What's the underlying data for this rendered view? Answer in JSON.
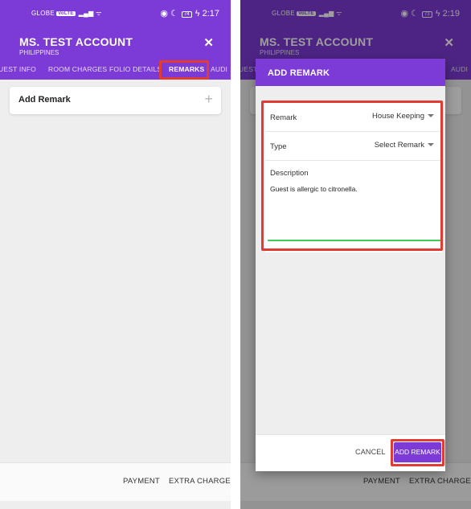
{
  "left": {
    "status": {
      "carrier": "GLOBE",
      "volte": "VoLTE",
      "battery": "74",
      "time": "2:17"
    },
    "header": {
      "title": "MS. TEST ACCOUNT",
      "subtitle": "PHILIPPINES"
    },
    "tabs": [
      {
        "label": "UEST INFO"
      },
      {
        "label": "ROOM CHARGES"
      },
      {
        "label": "FOLIO DETAILS"
      },
      {
        "label": "REMARKS"
      },
      {
        "label": "AUDI"
      }
    ],
    "add_remark_label": "Add Remark",
    "bottom": {
      "payment": "PAYMENT",
      "extra_charge": "EXTRA CHARGE"
    }
  },
  "right": {
    "status": {
      "carrier": "GLOBE",
      "volte": "VoLTE",
      "battery": "73",
      "time": "2:19"
    },
    "header": {
      "title": "MS. TEST ACCOUNT",
      "subtitle": "PHILIPPINES"
    },
    "tab_left_fragment": "UEST",
    "tab_right_fragment": "AUDI",
    "dialog": {
      "title": "ADD REMARK",
      "remark_label": "Remark",
      "remark_value": "House Keeping",
      "type_label": "Type",
      "type_value": "Select Remark",
      "description_label": "Description",
      "description_text": "Guest is allergic to citronella.",
      "cancel": "CANCEL",
      "add": "ADD REMARK"
    },
    "bottom": {
      "payment": "PAYMENT",
      "extra_charge": "EXTRA CHARGE"
    }
  },
  "icons": {
    "close": "close-icon",
    "plus": "plus-icon",
    "caret": "caret-down-icon"
  },
  "colors": {
    "accent": "#7c3ad6",
    "highlight": "#e03c33",
    "field_underline": "#3ccc5c"
  }
}
